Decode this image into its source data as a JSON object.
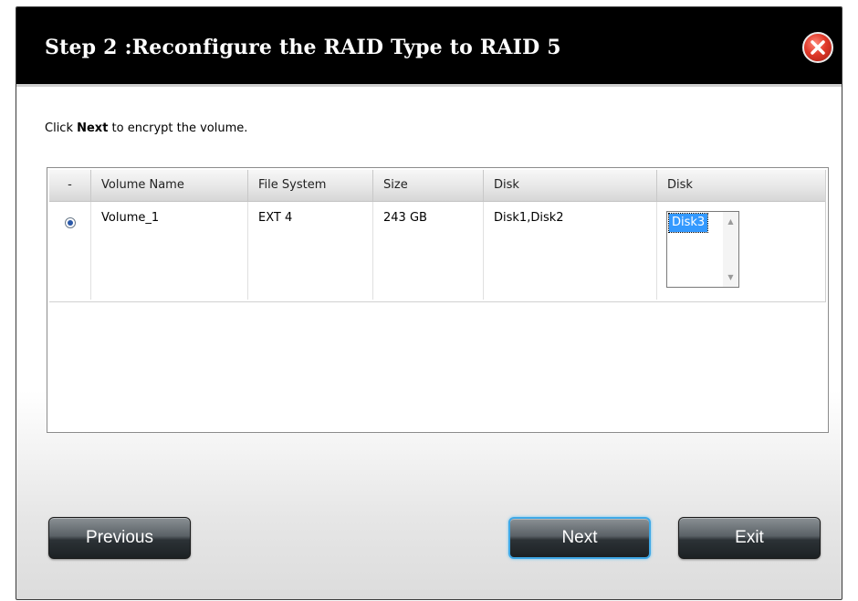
{
  "dialog": {
    "title": "Step 2 :Reconfigure the RAID Type to RAID 5",
    "instruction": {
      "prefix": "Click ",
      "bold": "Next",
      "suffix": " to encrypt the volume."
    }
  },
  "table": {
    "headers": [
      "-",
      "Volume Name",
      "File System",
      "Size",
      "Disk",
      "Disk"
    ],
    "rows": [
      {
        "volume_name": "Volume_1",
        "file_system": "EXT 4",
        "size": "243 GB",
        "disk": "Disk1,Disk2",
        "selected": true,
        "available_disks": [
          "Disk3"
        ]
      }
    ]
  },
  "buttons": {
    "previous": "Previous",
    "next": "Next",
    "exit": "Exit"
  },
  "icons": {
    "close": "close-icon",
    "scroll_up": "chevron-up-icon",
    "scroll_down": "chevron-down-icon"
  },
  "colors": {
    "titlebar": "#000000",
    "close_button": "#e0392a",
    "selection": "#3399ff",
    "focus_ring": "#3fa8e6"
  }
}
